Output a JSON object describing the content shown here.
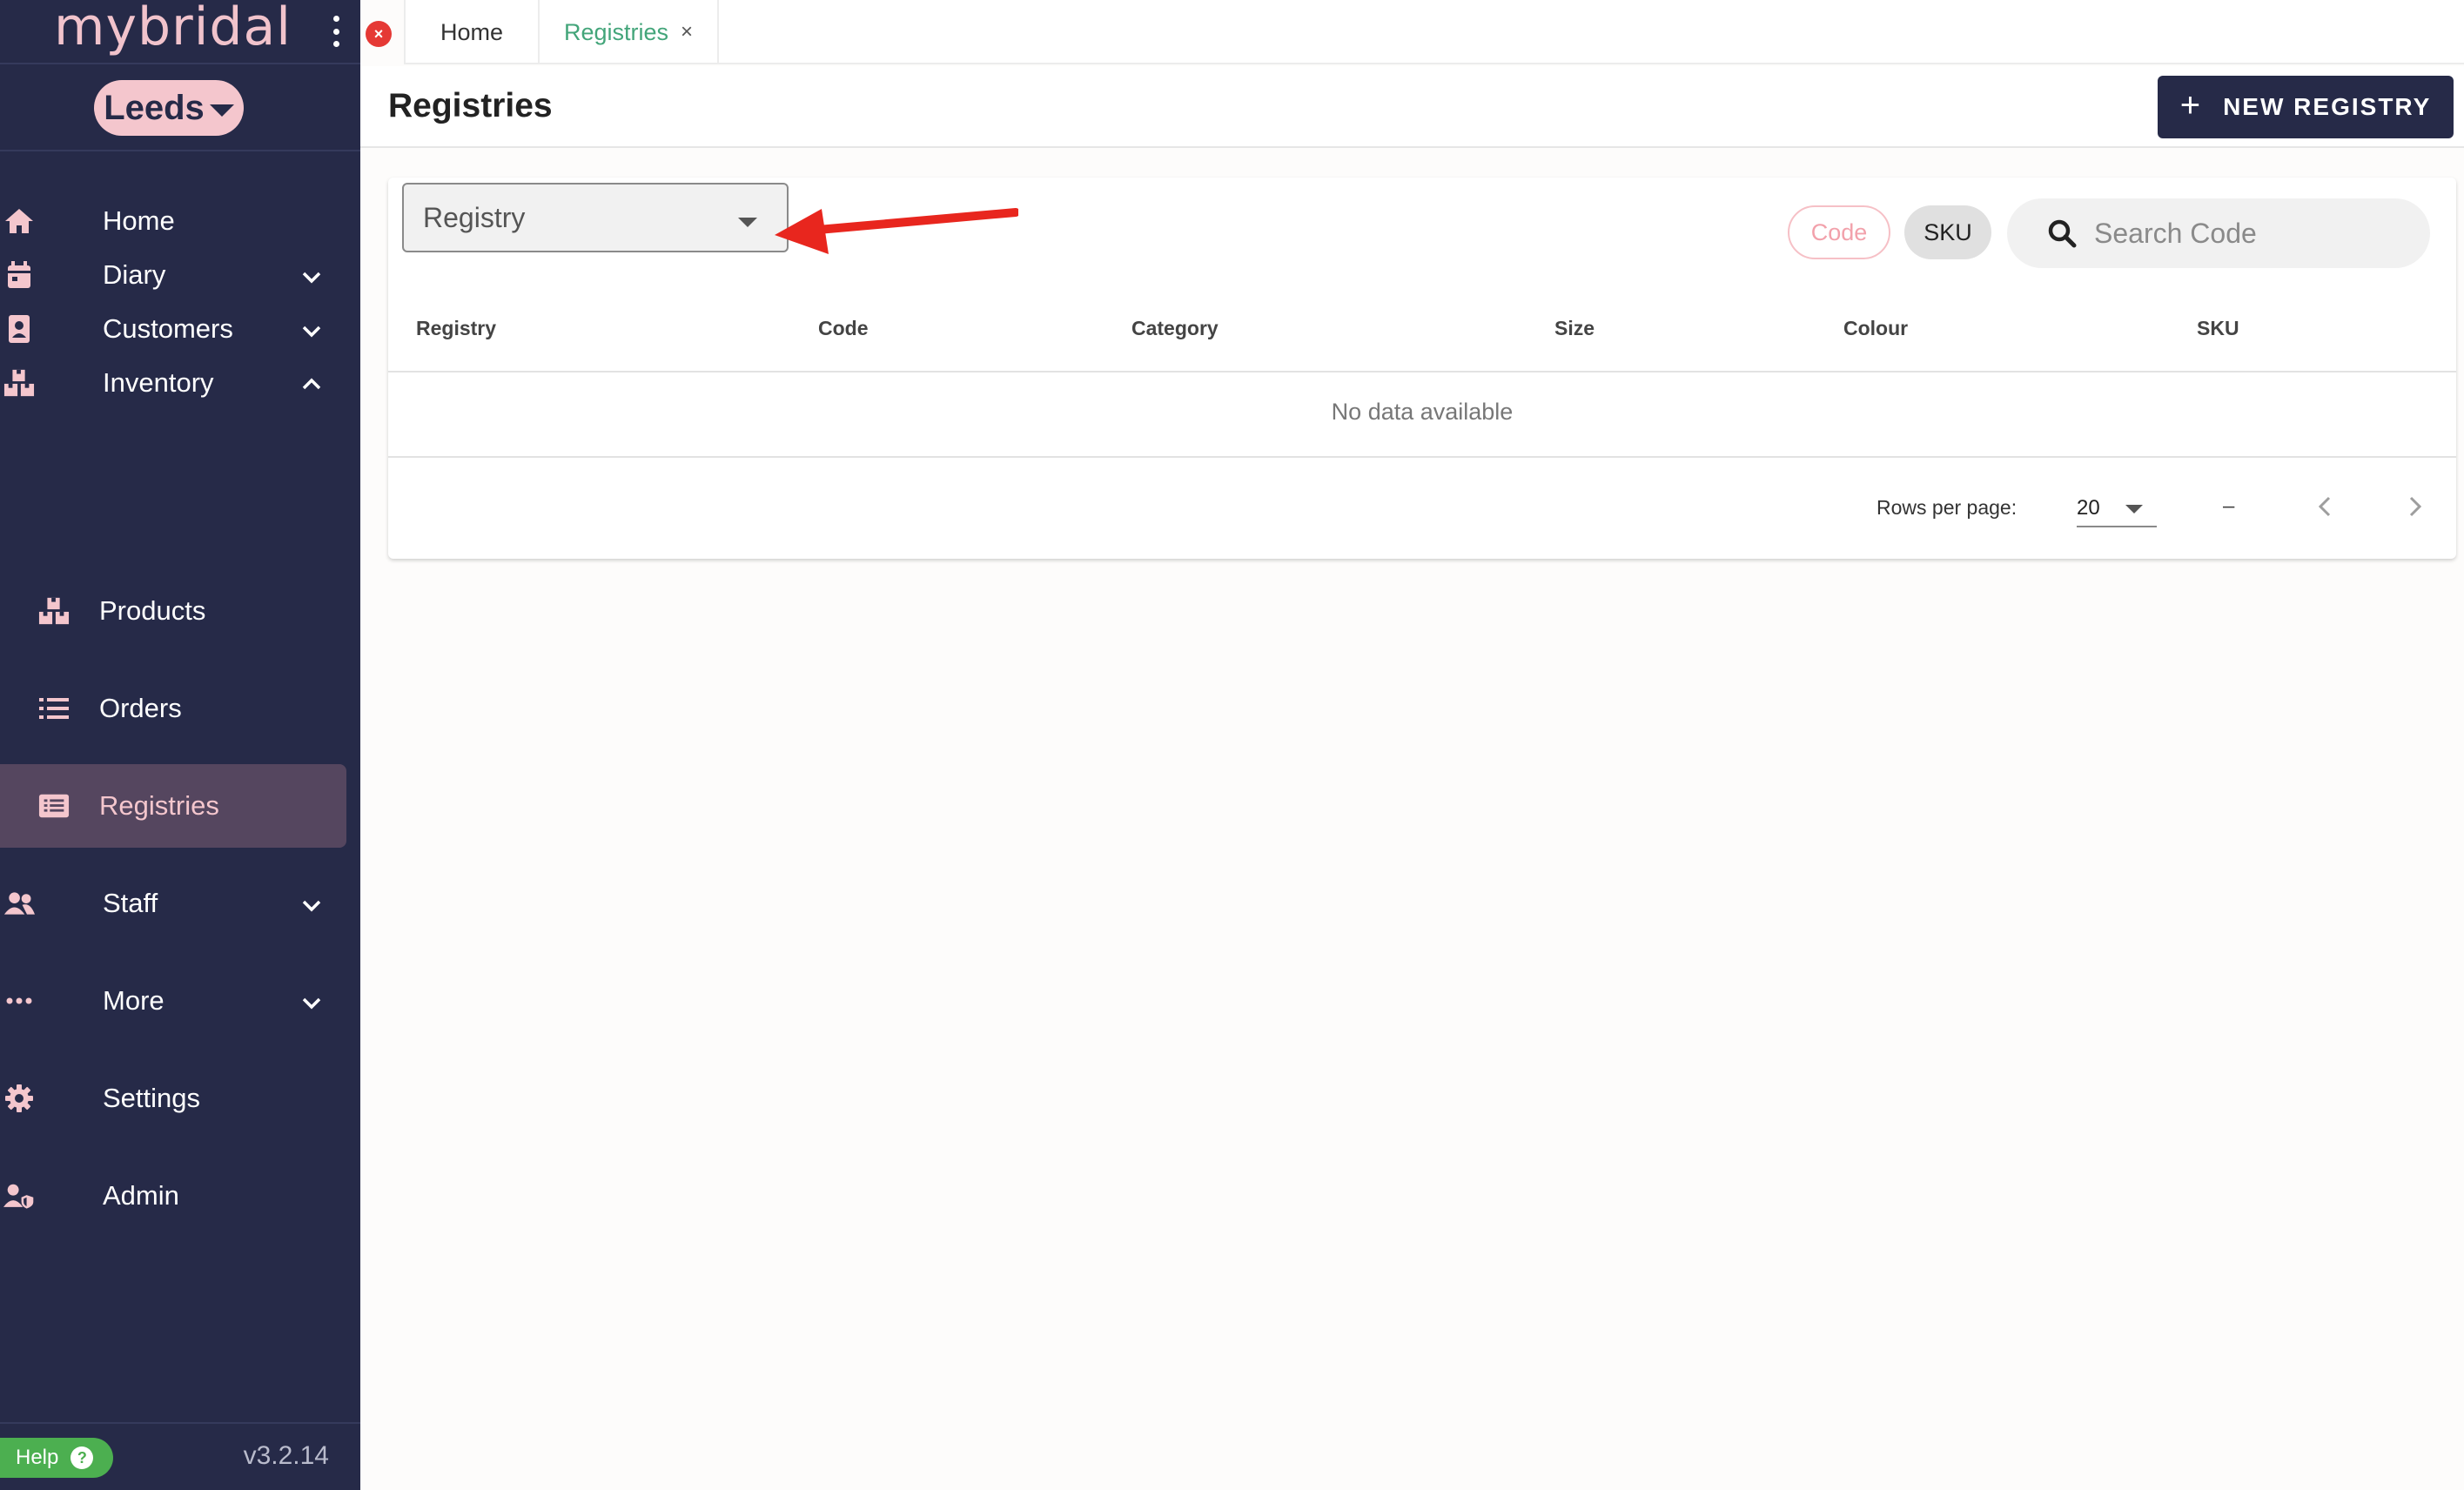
{
  "app": {
    "brand": "mybridal",
    "location": "Leeds",
    "version": "v3.2.14",
    "help_label": "Help",
    "help_glyph": "?"
  },
  "sidebar": {
    "items": [
      {
        "label": "Home",
        "icon": "home-icon"
      },
      {
        "label": "Diary",
        "icon": "calendar-icon",
        "expand": "chevron-down-icon"
      },
      {
        "label": "Customers",
        "icon": "contact-card-icon",
        "expand": "chevron-down-icon"
      },
      {
        "label": "Inventory",
        "icon": "boxes-icon",
        "expand": "chevron-up-icon"
      },
      {
        "label": "Products",
        "icon": "boxes-icon"
      },
      {
        "label": "Orders",
        "icon": "list-icon"
      },
      {
        "label": "Registries",
        "icon": "registry-icon",
        "active": true
      },
      {
        "label": "Staff",
        "icon": "people-icon",
        "expand": "chevron-down-icon"
      },
      {
        "label": "More",
        "icon": "dots-icon",
        "expand": "chevron-down-icon"
      },
      {
        "label": "Settings",
        "icon": "gear-icon"
      },
      {
        "label": "Admin",
        "icon": "user-shield-icon"
      }
    ]
  },
  "tabs": {
    "close_all_glyph": "×",
    "items": [
      {
        "label": "Home"
      },
      {
        "label": "Registries",
        "active": true,
        "close": "×"
      }
    ]
  },
  "page": {
    "title": "Registries",
    "new_button": {
      "plus": "+",
      "label": "NEW REGISTRY"
    }
  },
  "filters": {
    "registry_select_label": "Registry",
    "chips": [
      {
        "label": "Code",
        "selected": true
      },
      {
        "label": "SKU",
        "selected": false
      }
    ],
    "search_placeholder": "Search Code"
  },
  "table": {
    "columns": [
      "Registry",
      "Code",
      "Category",
      "Size",
      "Colour",
      "SKU"
    ],
    "rows": [],
    "empty_text": "No data available"
  },
  "pagination": {
    "rows_per_page_label": "Rows per page:",
    "rows_per_page_value": "20",
    "range_text": "–"
  },
  "colors": {
    "sidebar_bg": "#262a48",
    "accent_pink": "#f4c6cd",
    "active_tab_text": "#43a57a",
    "primary_button": "#262a48",
    "annotation_arrow": "#e8261e",
    "help_green": "#4caf50"
  }
}
